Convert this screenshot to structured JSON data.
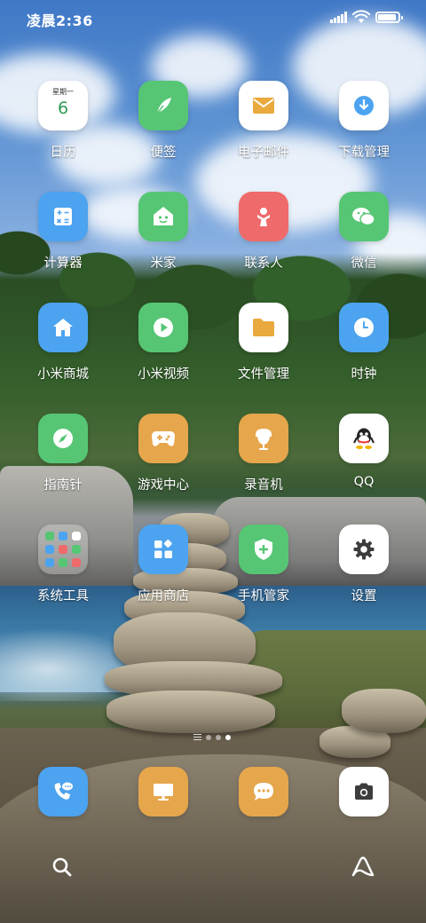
{
  "status_bar": {
    "time": "凌晨2:36",
    "battery_level_percent": 90
  },
  "apps": [
    {
      "label": "日历",
      "icon": "calendar-icon",
      "color": "#ffffff",
      "calendar_day": "星期一",
      "calendar_date": "6"
    },
    {
      "label": "便签",
      "icon": "notes-icon",
      "color": "#56c675"
    },
    {
      "label": "电子邮件",
      "icon": "email-icon",
      "color": "#ffffff"
    },
    {
      "label": "下载管理",
      "icon": "download-icon",
      "color": "#ffffff"
    },
    {
      "label": "计算器",
      "icon": "calculator-icon",
      "color": "#4ca3ef"
    },
    {
      "label": "米家",
      "icon": "mijia-icon",
      "color": "#56c675"
    },
    {
      "label": "联系人",
      "icon": "contacts-icon",
      "color": "#ef6a6a"
    },
    {
      "label": "微信",
      "icon": "wechat-icon",
      "color": "#56c675"
    },
    {
      "label": "小米商城",
      "icon": "mi-store-icon",
      "color": "#4ca3ef"
    },
    {
      "label": "小米视频",
      "icon": "mi-video-icon",
      "color": "#56c675"
    },
    {
      "label": "文件管理",
      "icon": "file-manager-icon",
      "color": "#ffffff"
    },
    {
      "label": "时钟",
      "icon": "clock-icon",
      "color": "#4ca3ef"
    },
    {
      "label": "指南针",
      "icon": "compass-icon",
      "color": "#56c675"
    },
    {
      "label": "游戏中心",
      "icon": "game-center-icon",
      "color": "#e6a64c"
    },
    {
      "label": "录音机",
      "icon": "recorder-icon",
      "color": "#e6a64c"
    },
    {
      "label": "QQ",
      "icon": "qq-icon",
      "color": "#ffffff"
    },
    {
      "label": "系统工具",
      "icon": "system-tools-folder-icon",
      "color": "#ffffff"
    },
    {
      "label": "应用商店",
      "icon": "app-store-icon",
      "color": "#4ca3ef"
    },
    {
      "label": "手机管家",
      "icon": "security-icon",
      "color": "#56c675"
    },
    {
      "label": "设置",
      "icon": "settings-icon",
      "color": "#ffffff"
    }
  ],
  "pager": {
    "pages": 3,
    "current": 3
  },
  "dock": [
    {
      "icon": "phone-icon",
      "color": "#4ca3ef"
    },
    {
      "icon": "browser-icon",
      "color": "#e6a64c"
    },
    {
      "icon": "messages-icon",
      "color": "#e6a64c"
    },
    {
      "icon": "camera-icon",
      "color": "#ffffff"
    }
  ],
  "bottom_bar": {
    "left_icon": "search-icon",
    "right_icon": "ai-assistant-icon"
  }
}
